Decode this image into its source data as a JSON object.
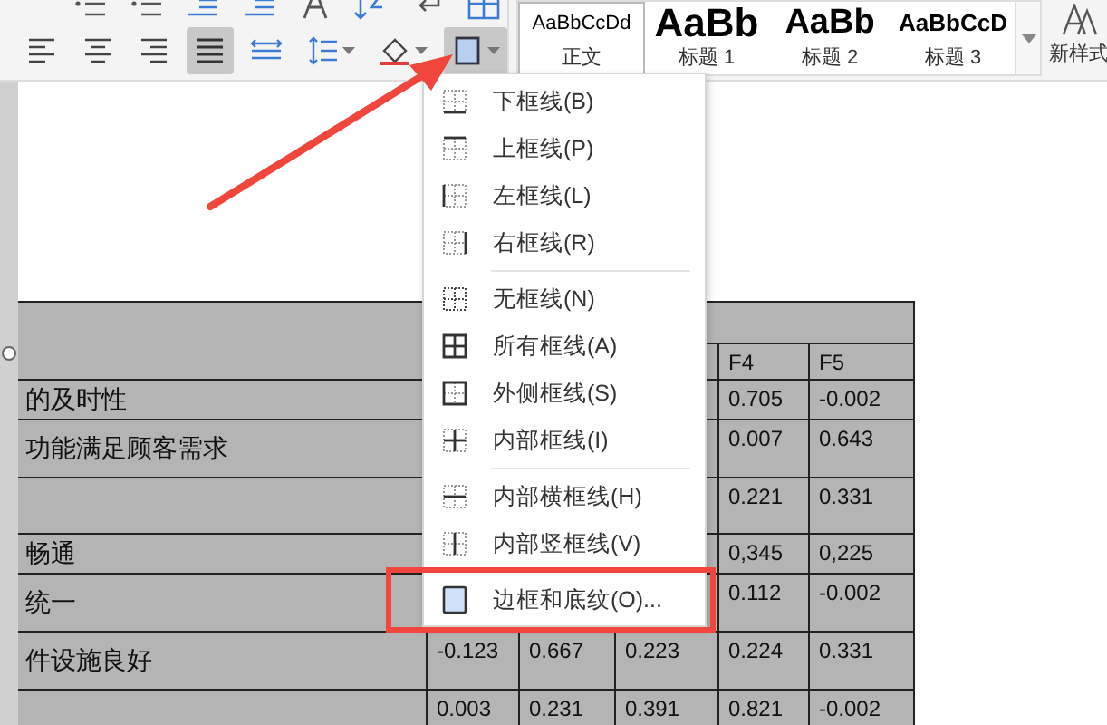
{
  "toolbar": {
    "top_row": [
      {
        "kind": "bullets"
      },
      {
        "kind": "numbering"
      },
      {
        "kind": "outdent"
      },
      {
        "kind": "indent"
      },
      {
        "kind": "font"
      },
      {
        "kind": "sort"
      },
      {
        "kind": "linebreak"
      },
      {
        "kind": "table"
      }
    ],
    "buttons": [
      {
        "kind": "align-left",
        "selected": false
      },
      {
        "kind": "align-center",
        "selected": false
      },
      {
        "kind": "align-right",
        "selected": false
      },
      {
        "kind": "justify",
        "selected": true
      },
      {
        "kind": "distribute",
        "selected": false
      },
      {
        "kind": "line-spacing",
        "selected": false
      },
      {
        "kind": "shading",
        "selected": false
      },
      {
        "kind": "borders",
        "selected": true
      }
    ]
  },
  "style_gallery": {
    "styles": [
      {
        "preview": "AaBbCcDd",
        "label": "正文",
        "kind": "normal",
        "selected": true
      },
      {
        "preview": "AaBb",
        "label": "标题 1",
        "kind": "heading1",
        "selected": false
      },
      {
        "preview": "AaBb",
        "label": "标题 2",
        "kind": "heading2",
        "selected": false
      },
      {
        "preview": "AaBbCcD",
        "label": "标题 3",
        "kind": "heading3",
        "selected": false
      }
    ],
    "new_style": "新样式"
  },
  "table": {
    "column_headers": [
      "F4",
      "F5"
    ],
    "rows": [
      {
        "label": "的及时性",
        "values": [
          "0.705",
          "-0.002"
        ]
      },
      {
        "label": "功能满足顾客需求",
        "values": [
          "0.007",
          "0.643"
        ]
      },
      {
        "values": [
          "0.221",
          "0.331"
        ]
      },
      {
        "label": "畅通",
        "values": [
          "0,345",
          "0,225"
        ]
      },
      {
        "label": "统一",
        "values": [
          "0.112",
          "-0.002"
        ]
      },
      {
        "label": "件设施良好",
        "values": [
          "-0.123",
          "0.667",
          "0.223",
          "0.224",
          "0.331"
        ]
      },
      {
        "values": [
          "0.003",
          "0.231",
          "0.391",
          "0.821",
          "-0.002"
        ]
      }
    ]
  },
  "border_menu": {
    "items": [
      {
        "kind": "bottom",
        "label": "下框线(B)",
        "highlighted": false
      },
      {
        "kind": "top",
        "label": "上框线(P)",
        "highlighted": false
      },
      {
        "kind": "left",
        "label": "左框线(L)",
        "highlighted": false
      },
      {
        "kind": "right",
        "label": "右框线(R)",
        "highlighted": false
      },
      {
        "kind": "separator"
      },
      {
        "kind": "none",
        "label": "无框线(N)",
        "highlighted": false
      },
      {
        "kind": "all",
        "label": "所有框线(A)",
        "highlighted": false
      },
      {
        "kind": "outside",
        "label": "外侧框线(S)",
        "highlighted": false
      },
      {
        "kind": "inside",
        "label": "内部框线(I)",
        "highlighted": false
      },
      {
        "kind": "separator"
      },
      {
        "kind": "inside-h",
        "label": "内部横框线(H)",
        "highlighted": false
      },
      {
        "kind": "inside-v",
        "label": "内部竖框线(V)",
        "highlighted": false
      },
      {
        "kind": "separator"
      },
      {
        "kind": "dialog",
        "label": "边框和底纹(O)...",
        "highlighted": true
      }
    ]
  }
}
